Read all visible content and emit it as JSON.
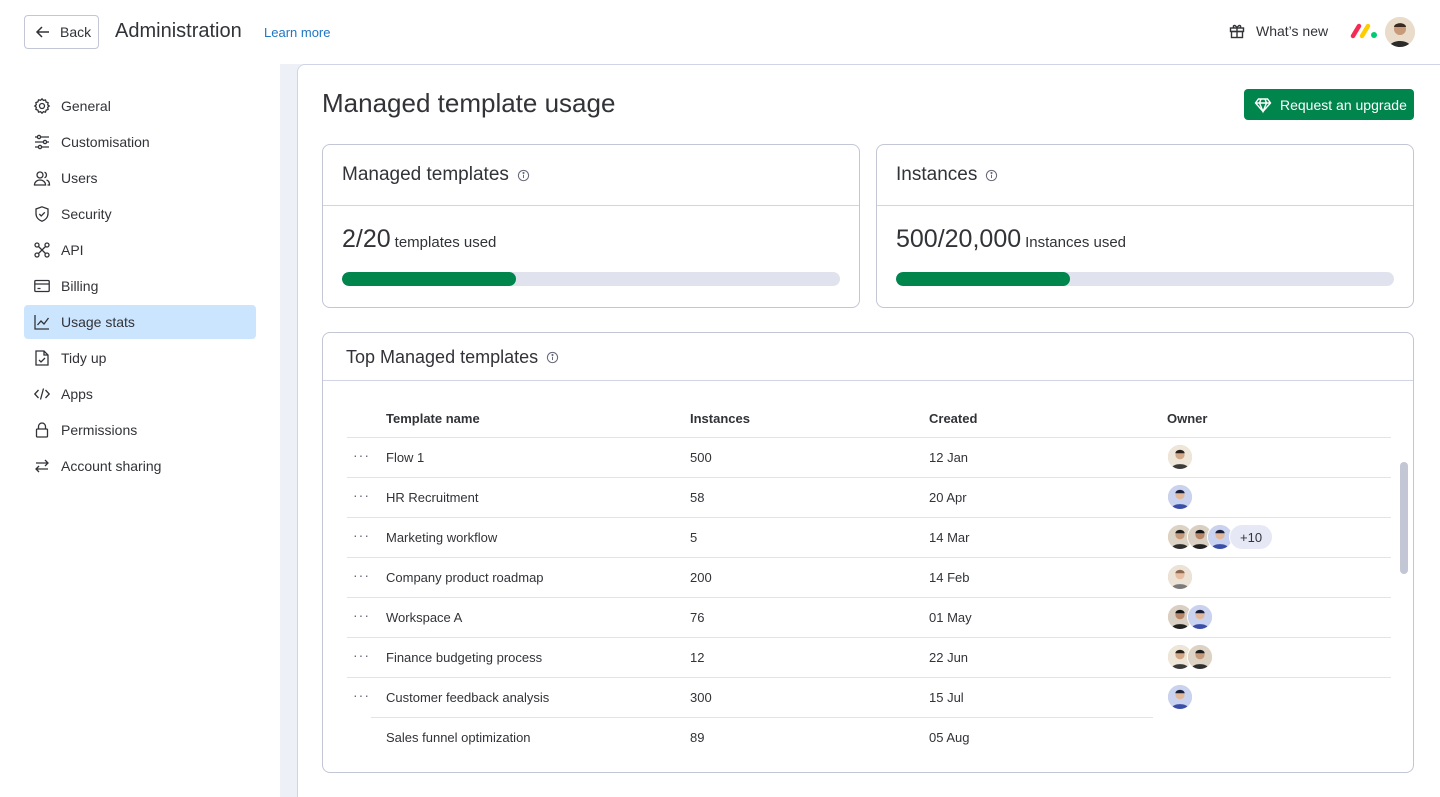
{
  "header": {
    "back_label": "Back",
    "title": "Administration",
    "learn_more": "Learn more",
    "whats_new": "What’s new"
  },
  "sidebar": {
    "items": [
      {
        "label": "General",
        "icon": "gear-icon"
      },
      {
        "label": "Customisation",
        "icon": "sliders-icon"
      },
      {
        "label": "Users",
        "icon": "users-icon"
      },
      {
        "label": "Security",
        "icon": "shield-icon"
      },
      {
        "label": "API",
        "icon": "api-icon"
      },
      {
        "label": "Billing",
        "icon": "card-icon"
      },
      {
        "label": "Usage stats",
        "icon": "chart-icon",
        "active": true
      },
      {
        "label": "Tidy up",
        "icon": "broom-icon"
      },
      {
        "label": "Apps",
        "icon": "code-icon"
      },
      {
        "label": "Permissions",
        "icon": "lock-icon"
      },
      {
        "label": "Account sharing",
        "icon": "swap-icon"
      }
    ]
  },
  "main": {
    "title": "Managed template usage",
    "upgrade_button": "Request an upgrade",
    "templates_card": {
      "title": "Managed templates",
      "value": "2/20",
      "suffix": "templates used",
      "progress": 0.35
    },
    "instances_card": {
      "title": "Instances",
      "value": "500/20,000",
      "suffix": "Instances used",
      "progress": 0.35
    },
    "table": {
      "title": "Top Managed templates",
      "columns": [
        "Template name",
        "Instances",
        "Created",
        "Owner"
      ],
      "rows": [
        {
          "name": " Flow 1",
          "instances": "500",
          "created": "12 Jan",
          "owners": 1,
          "more": ""
        },
        {
          "name": "HR Recruitment",
          "instances": "58",
          "created": "20 Apr",
          "owners": 1,
          "more": ""
        },
        {
          "name": "Marketing workflow",
          "instances": "5",
          "created": "14 Mar",
          "owners": 3,
          "more": "+10"
        },
        {
          "name": "Company product roadmap",
          "instances": "200",
          "created": "14 Feb",
          "owners": 1,
          "more": ""
        },
        {
          "name": " Workspace A",
          "instances": "76",
          "created": "01 May",
          "owners": 2,
          "more": ""
        },
        {
          "name": "Finance budgeting process",
          "instances": "12",
          "created": "22 Jun",
          "owners": 2,
          "more": ""
        },
        {
          "name": "Customer feedback analysis",
          "instances": "300",
          "created": "15 Jul",
          "owners": 1,
          "more": ""
        },
        {
          "name": "Sales funnel optimization",
          "instances": "89",
          "created": "05 Aug",
          "owners": 0,
          "more": ""
        }
      ]
    }
  },
  "colors": {
    "accent_green": "#00854d",
    "link_blue": "#1f76c2",
    "active_nav": "#cce5ff"
  }
}
